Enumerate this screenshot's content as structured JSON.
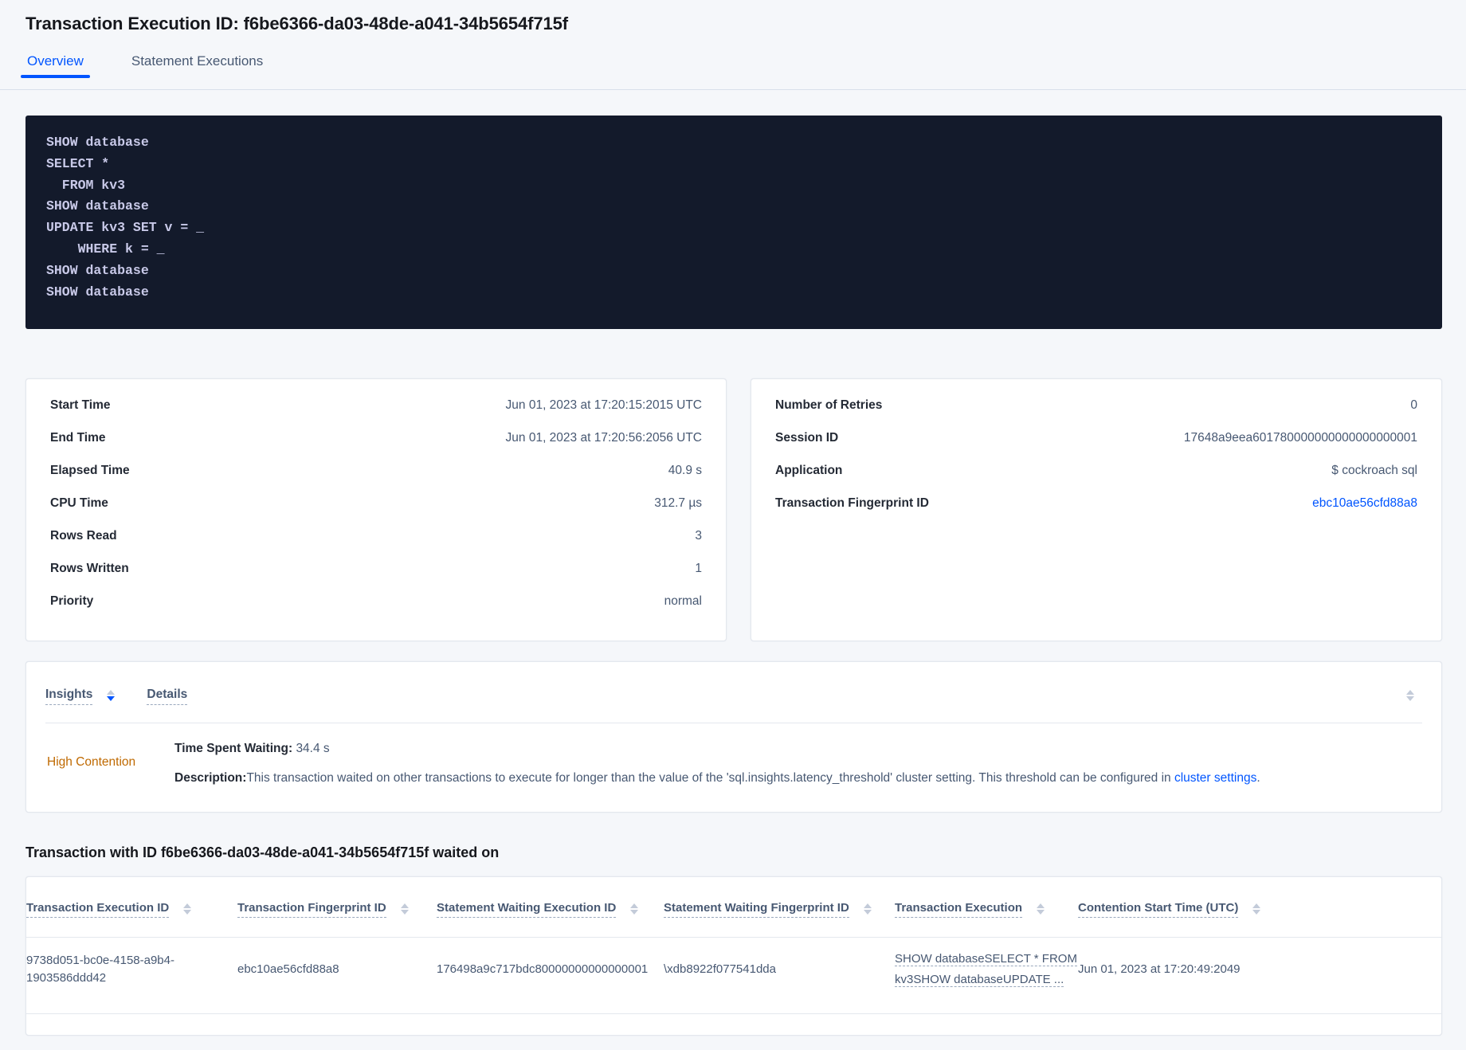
{
  "header": {
    "title": "Transaction Execution ID: f6be6366-da03-48de-a041-34b5654f715f",
    "tabs": [
      {
        "label": "Overview",
        "active": true
      },
      {
        "label": "Statement Executions",
        "active": false
      }
    ]
  },
  "code_block": {
    "language": "sql",
    "text": "SHOW database\nSELECT *\n  FROM kv3\nSHOW database\nUPDATE kv3 SET v = _\n    WHERE k = _\nSHOW database\nSHOW database",
    "background": "#131a2b",
    "foreground": "#c8c9e8"
  },
  "summary_left": [
    {
      "label": "Start Time",
      "value": "Jun 01, 2023 at 17:20:15:2015 UTC"
    },
    {
      "label": "End Time",
      "value": "Jun 01, 2023 at 17:20:56:2056 UTC"
    },
    {
      "label": "Elapsed Time",
      "value": "40.9 s"
    },
    {
      "label": "CPU Time",
      "value": "312.7 µs"
    },
    {
      "label": "Rows Read",
      "value": "3"
    },
    {
      "label": "Rows Written",
      "value": "1"
    },
    {
      "label": "Priority",
      "value": "normal"
    }
  ],
  "summary_right": [
    {
      "label": "Number of Retries",
      "value": "0",
      "link": false
    },
    {
      "label": "Session ID",
      "value": "17648a9eea601780000000000000000001",
      "link": false
    },
    {
      "label": "Application",
      "value": "$ cockroach sql",
      "link": false
    },
    {
      "label": "Transaction Fingerprint ID",
      "value": "ebc10ae56cfd88a8",
      "link": true
    }
  ],
  "insights": {
    "columns": {
      "insights": "Insights",
      "details": "Details"
    },
    "sort": {
      "column": "Insights",
      "direction": "desc"
    },
    "rows": [
      {
        "type": "High Contention",
        "type_color": "#bf6900",
        "time_spent_waiting_label": "Time Spent Waiting:",
        "time_spent_waiting_value": "34.4 s",
        "description_label": "Description:",
        "description_text": "This transaction waited on other transactions to execute for longer than the value of the 'sql.insights.latency_threshold' cluster setting. This threshold can be configured in ",
        "description_link": "cluster settings",
        "description_tail": "."
      }
    ]
  },
  "waited_on": {
    "title": "Transaction with ID f6be6366-da03-48de-a041-34b5654f715f waited on",
    "columns": [
      "Transaction Execution ID",
      "Transaction Fingerprint ID",
      "Statement Waiting Execution ID",
      "Statement Waiting Fingerprint ID",
      "Transaction Execution",
      "Contention Start Time (UTC)"
    ],
    "rows": [
      {
        "transaction_execution_id": "9738d051-bc0e-4158-a9b4-1903586ddd42",
        "transaction_fingerprint_id": "ebc10ae56cfd88a8",
        "statement_waiting_execution_id": "176498a9c717bdc80000000000000001",
        "statement_waiting_fingerprint_id": "\\xdb8922f077541dda",
        "transaction_execution": "SHOW databaseSELECT * FROM kv3SHOW databaseUPDATE ...",
        "contention_start_time": "Jun 01, 2023 at 17:20:49:2049"
      }
    ]
  },
  "colors": {
    "accent": "#0055ff",
    "page_background": "#f5f7fa",
    "warning": "#bf6900",
    "text_primary": "#242a35",
    "text_secondary": "#475872"
  }
}
